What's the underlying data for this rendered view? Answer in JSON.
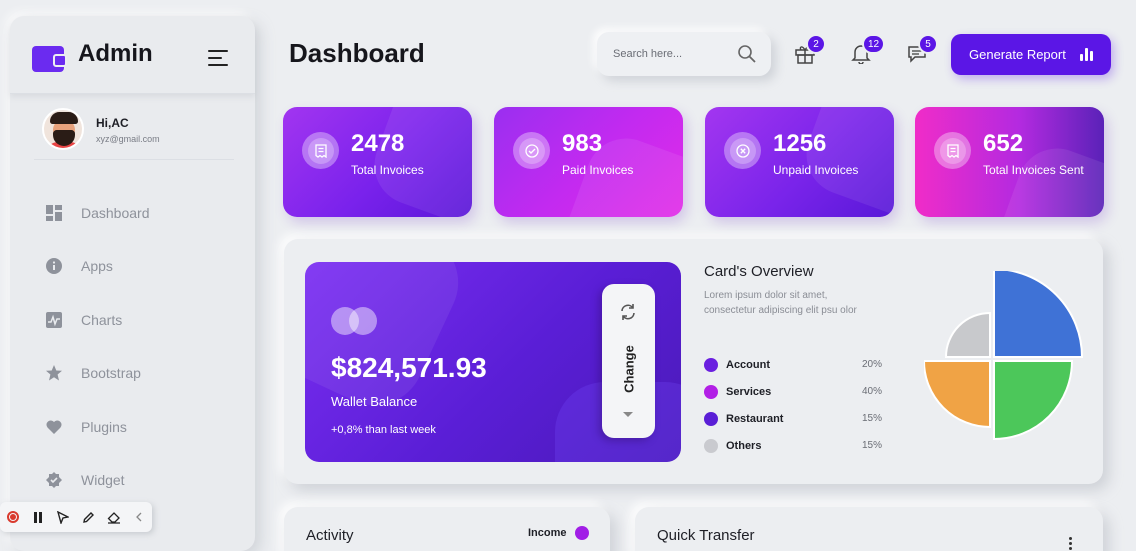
{
  "sidebar": {
    "brand": "Admin",
    "profile": {
      "greeting": "Hi,AC",
      "email": "xyz@gmail.com"
    },
    "items": [
      {
        "label": "Dashboard",
        "icon": "dashboard-icon"
      },
      {
        "label": "Apps",
        "icon": "info-icon"
      },
      {
        "label": "Charts",
        "icon": "chart-icon"
      },
      {
        "label": "Bootstrap",
        "icon": "star-icon"
      },
      {
        "label": "Plugins",
        "icon": "heart-icon"
      },
      {
        "label": "Widget",
        "icon": "badge-icon"
      }
    ]
  },
  "header": {
    "title": "Dashboard",
    "search_placeholder": "Search here...",
    "badges": {
      "gift": "2",
      "bell": "12",
      "chat": "5"
    },
    "generate_button": "Generate Report"
  },
  "stats": [
    {
      "value": "2478",
      "label": "Total Invoices"
    },
    {
      "value": "983",
      "label": "Paid Invoices"
    },
    {
      "value": "1256",
      "label": "Unpaid Invoices"
    },
    {
      "value": "652",
      "label": "Total Invoices Sent"
    }
  ],
  "wallet": {
    "balance": "$824,571.93",
    "label": "Wallet Balance",
    "change": "+0,8% than last week",
    "change_button": "Change"
  },
  "overview": {
    "title": "Card's Overview",
    "description": "Lorem ipsum dolor sit amet, consectetur adipiscing elit psu olor",
    "legend": [
      {
        "name": "Account",
        "pct": "20%",
        "color": "#6a1fe0"
      },
      {
        "name": "Services",
        "pct": "40%",
        "color": "#b21fe6"
      },
      {
        "name": "Restaurant",
        "pct": "15%",
        "color": "#5a1ed6"
      },
      {
        "name": "Others",
        "pct": "15%",
        "color": "#c9cacf"
      }
    ]
  },
  "pie_colors": {
    "blue": "#3f72d6",
    "green": "#4cc75a",
    "orange": "#f0a345",
    "gray": "#c8c9cc"
  },
  "bottom": {
    "activity_title": "Activity",
    "income_label": "Income",
    "transfer_title": "Quick Transfer"
  }
}
